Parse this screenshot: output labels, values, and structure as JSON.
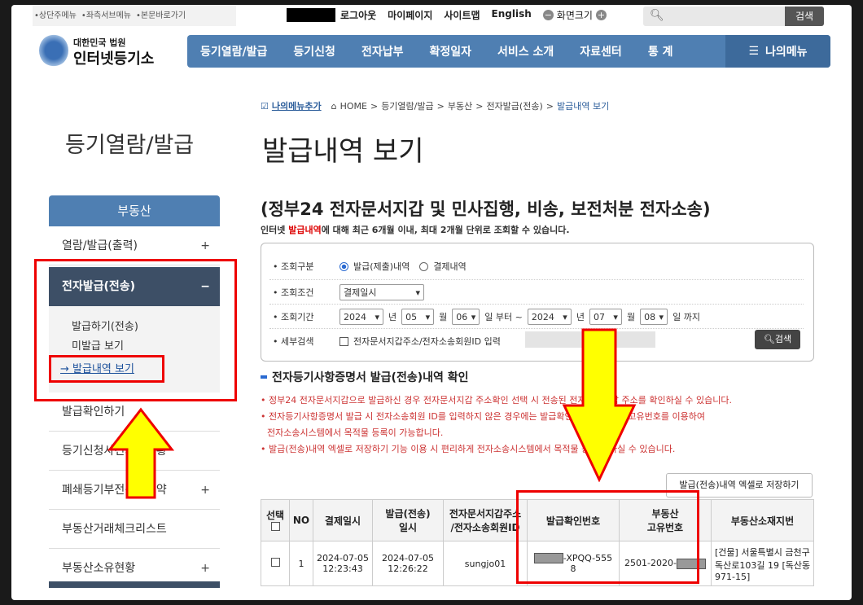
{
  "skipnav": {
    "a": "상단주메뉴",
    "b": "좌측서브메뉴",
    "c": "본문바로가기"
  },
  "util": {
    "logout": "로그아웃",
    "mypage": "마이페이지",
    "sitemap": "사이트맵",
    "english": "English",
    "zoom": "화면크기",
    "zoom_minus": "−",
    "zoom_plus": "+"
  },
  "search": {
    "button": "검색"
  },
  "logo": {
    "org": "대한민국 법원",
    "name": "인터넷등기소"
  },
  "nav": [
    "등기열람/발급",
    "등기신청",
    "전자납부",
    "확정일자",
    "서비스 소개",
    "자료센터",
    "통 계"
  ],
  "mymenu": "나의메뉴",
  "sidebar": {
    "title": "등기열람/발급",
    "head": "부동산",
    "items": [
      {
        "label": "열람/발급(출력)",
        "pm": "+"
      },
      {
        "label": "전자발급(전송)",
        "pm": "−"
      },
      {
        "label": "발급확인하기",
        "pm": ""
      },
      {
        "label": "등기신청사건처리현황",
        "pm": ""
      },
      {
        "label": "폐쇄등기부전산화예약",
        "pm": "+"
      },
      {
        "label": "부동산거래체크리스트",
        "pm": ""
      },
      {
        "label": "부동산소유현황",
        "pm": "+"
      }
    ],
    "sub": [
      "발급하기(전송)",
      "미발급 보기",
      "→ 발급내역 보기"
    ]
  },
  "breadcrumb": {
    "mymenu_add": "나의메뉴추가",
    "home": "HOME",
    "c1": "등기열람/발급",
    "c2": "부동산",
    "c3": "전자발급(전송)",
    "c4": "발급내역 보기"
  },
  "page": {
    "title": "발급내역 보기",
    "subtitle": "(정부24 전자문서지갑 및 민사집행, 비송, 보전처분 전자소송)",
    "desc_pre": "인터넷 ",
    "desc_em": "발급내역",
    "desc_post": "에 대해 최근 6개월 이내, 최대 2개월 단위로 조회할 수 있습니다."
  },
  "form": {
    "type_label": "조회구분",
    "opt1": "발급(제출)내역",
    "opt2": "결제내역",
    "cond_label": "조회조건",
    "cond_value": "결제일시",
    "period_label": "조회기간",
    "y1": "2024",
    "m1": "05",
    "d1": "06",
    "y2": "2024",
    "m2": "07",
    "d2": "08",
    "t_year": "년",
    "t_month": "월",
    "t_from": "일 부터 ~",
    "t_to": "일 까지",
    "detail_label": "세부검색",
    "detail_check": "전자문서지갑주소/전자소송회원ID 입력",
    "search_btn": "검색"
  },
  "section": {
    "title": "전자등기사항증명서 발급(전송)내역 확인",
    "notes": [
      "정부24 전자문서지갑으로 발급하신 경우 전자문서지갑 주소확인 선택 시 전송된 전자문서지갑 주소를 확인하실 수 있습니다.",
      "전자등기사항증명서 발급 시 전자소송회원 ID를 입력하지 않은 경우에는 발급확인번호와 부동산 고유번호를 이용하여",
      "전자소송시스템에서 목적물 등록이 가능합니다.",
      "발급(전송)내역 엑셀로 저장하기 기능 이용 시 편리하게 전자소송시스템에서 목적물 등록을 하실 수 있습니다."
    ],
    "excel_btn": "발급(전송)내역 엑셀로 저장하기"
  },
  "table": {
    "headers": [
      "선택",
      "NO",
      "결제일시",
      "발급(전송)\n일시",
      "전자문서지갑주소\n/전자소송회원ID",
      "발급확인번호",
      "부동산\n고유번호",
      "부동산소재지번"
    ],
    "row": {
      "no": "1",
      "pay_date": "2024-07-05",
      "pay_time": "12:23:43",
      "iss_date": "2024-07-05",
      "iss_time": "12:26:22",
      "id": "sungjo01",
      "confirm_suffix": "-XPQQ-555",
      "confirm_tail": "8",
      "unique_prefix": "2501-2020-",
      "address": "[건물] 서울특별시 금천구 독산로103길 19 [독산동 971-15]"
    }
  }
}
